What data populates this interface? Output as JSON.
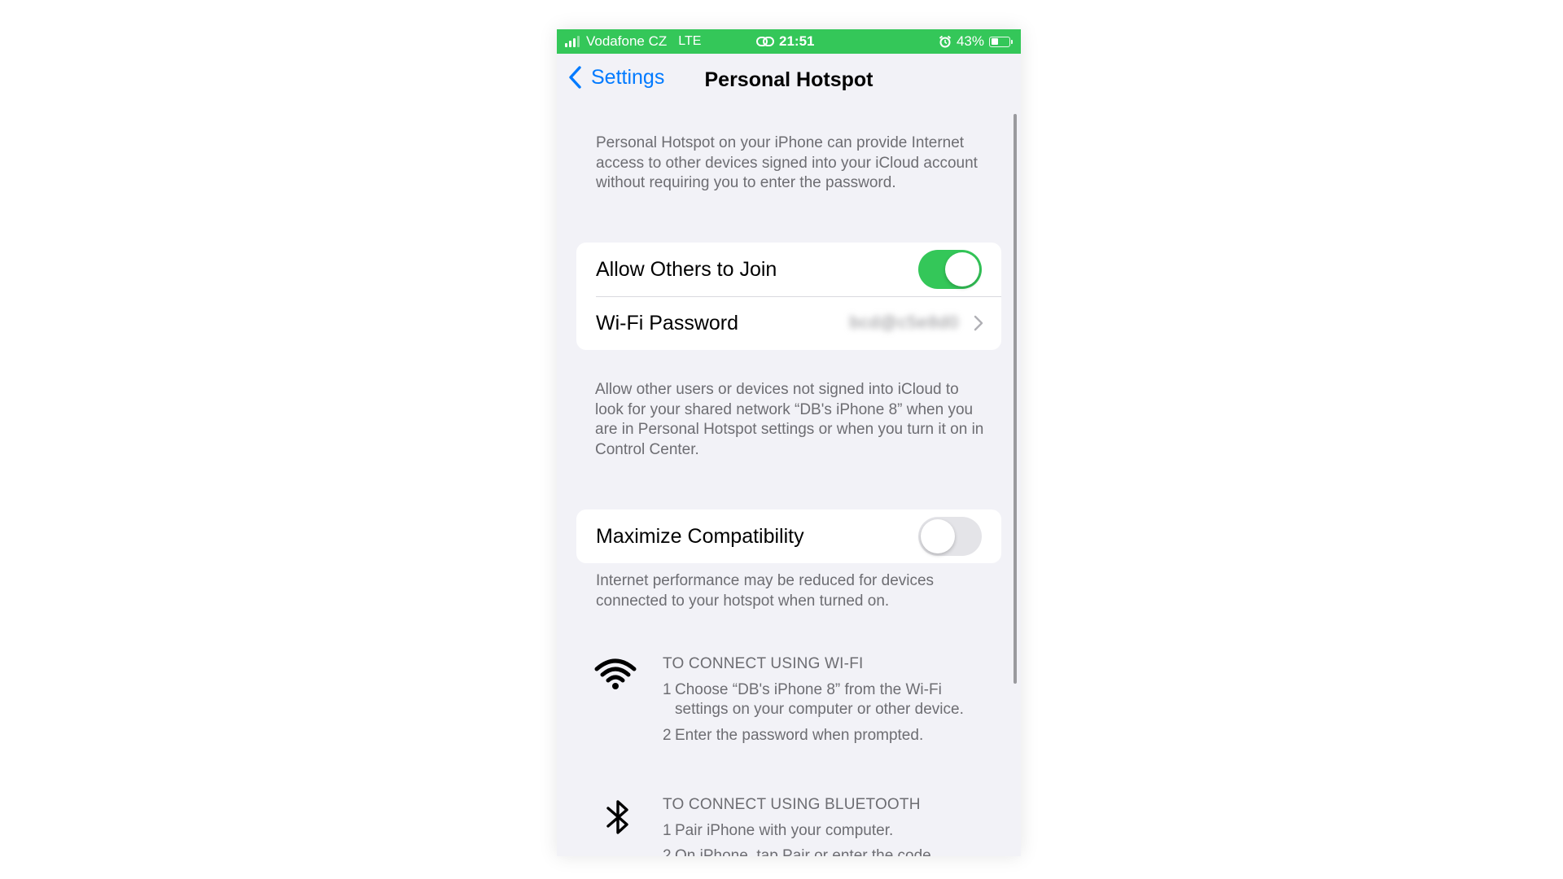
{
  "status_bar": {
    "carrier": "Vodafone CZ",
    "network": "LTE",
    "time": "21:51",
    "battery_text": "43%",
    "battery_level": 0.43,
    "signal_bars": 3,
    "icons": [
      "signal-icon",
      "hotspot-link-icon",
      "alarm-icon",
      "battery-icon"
    ]
  },
  "colors": {
    "status_bar_bg": "#34c759",
    "accent": "#007aff",
    "toggle_on": "#34c759",
    "background": "#f2f2f7"
  },
  "nav": {
    "back_label": "Settings",
    "title": "Personal Hotspot",
    "back_icon": "chevron-left-icon"
  },
  "intro_text": "Personal Hotspot on your iPhone can provide Internet access to other devices signed into your iCloud account without requiring you to enter the password.",
  "group1": {
    "allow_label": "Allow Others to Join",
    "allow_on": true,
    "wifi_label": "Wi-Fi Password",
    "wifi_value": "bcd@c5e8d0",
    "chevron_icon": "chevron-right-icon"
  },
  "allow_desc": "Allow other users or devices not signed into iCloud to look for your shared network “DB's iPhone 8” when you are in Personal Hotspot settings or when you turn it on in Control Center.",
  "group2": {
    "max_label": "Maximize Compatibility",
    "max_on": false
  },
  "max_desc": "Internet performance may be reduced for devices connected to your hotspot when turned on.",
  "wifi_instructions": {
    "icon": "wifi-icon",
    "header": "TO CONNECT USING WI-FI",
    "steps": [
      {
        "num": "1",
        "text": "Choose “DB's iPhone 8” from the Wi-Fi settings on your computer or other device."
      },
      {
        "num": "2",
        "text": "Enter the password when prompted."
      }
    ]
  },
  "bt_instructions": {
    "icon": "bluetooth-icon",
    "header": "TO CONNECT USING BLUETOOTH",
    "steps": [
      {
        "num": "1",
        "text": "Pair iPhone with your computer."
      },
      {
        "num": "2",
        "text": "On iPhone, tap Pair or enter the code"
      }
    ]
  }
}
